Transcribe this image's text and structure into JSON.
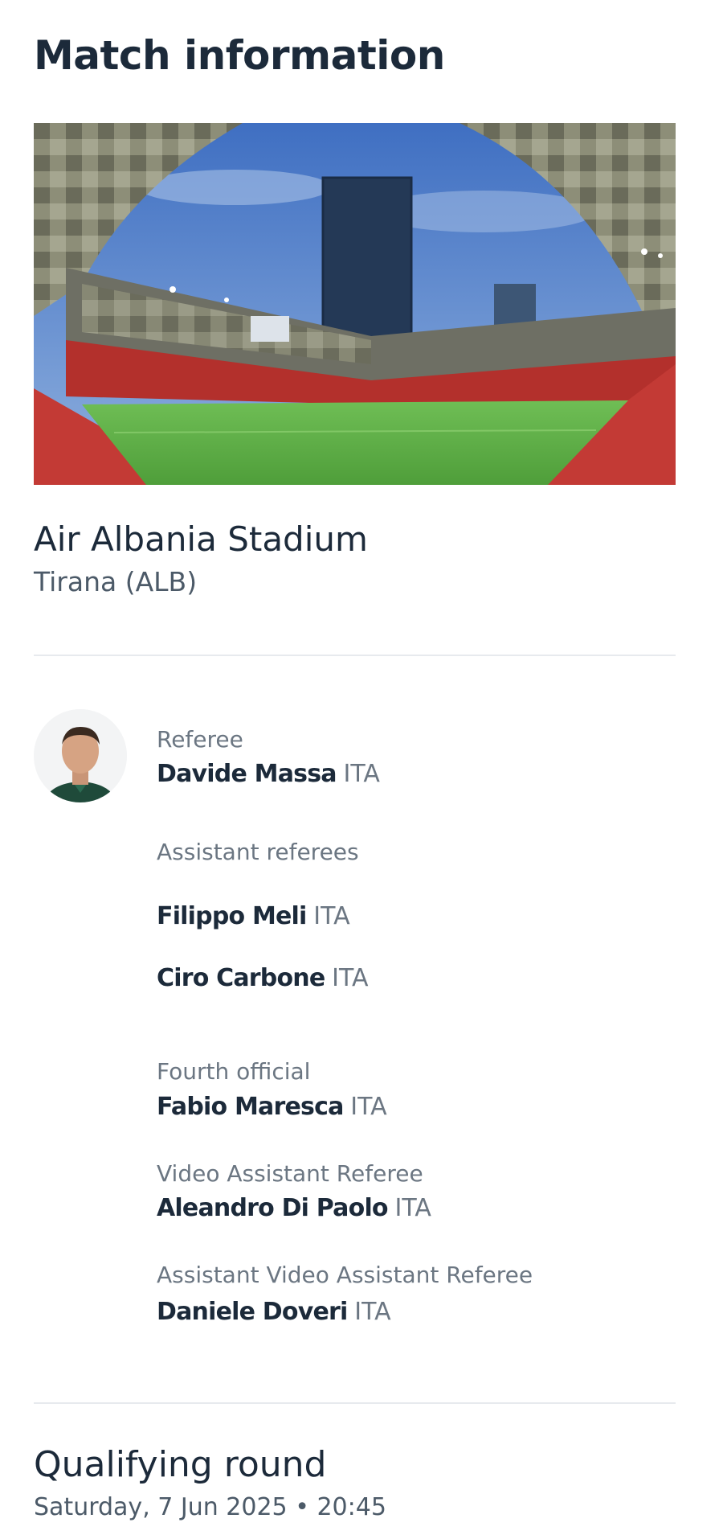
{
  "page_title": "Match information",
  "venue": {
    "name": "Air Albania Stadium",
    "city": "Tirana (ALB)"
  },
  "officials": {
    "referee": {
      "role": "Referee",
      "name": "Davide Massa",
      "nat": "ITA"
    },
    "assistants": {
      "role": "Assistant referees",
      "people": [
        {
          "name": "Filippo Meli",
          "nat": "ITA"
        },
        {
          "name": "Ciro Carbone",
          "nat": "ITA"
        }
      ]
    },
    "fourth": {
      "role": "Fourth official",
      "name": "Fabio Maresca",
      "nat": "ITA"
    },
    "var": {
      "role": "Video Assistant Referee",
      "name": "Aleandro Di Paolo",
      "nat": "ITA"
    },
    "avar": {
      "role": "Assistant Video Assistant Referee",
      "name": "Daniele Doveri",
      "nat": "ITA"
    }
  },
  "round": {
    "title": "Qualifying round",
    "date": "Saturday, 7 Jun 2025",
    "separator": "•",
    "time": "20:45"
  }
}
